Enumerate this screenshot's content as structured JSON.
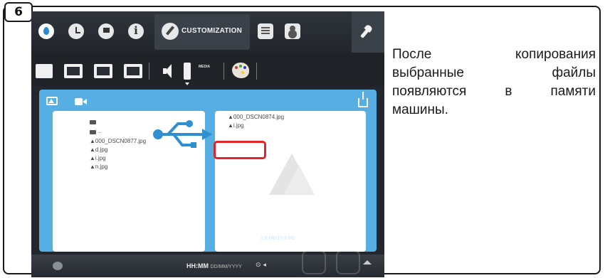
{
  "step_number": "6",
  "tabs": {
    "active_label": "CUSTOMIZATION"
  },
  "subbar": {
    "media_label": "MEDIA"
  },
  "usb_list": {
    "items": [
      {
        "type": "folder",
        "name": ""
      },
      {
        "type": "folder",
        "name": ".."
      },
      {
        "type": "image",
        "name": "000_DSCN0877.jpg"
      },
      {
        "type": "image",
        "name": "d.jpg"
      },
      {
        "type": "image",
        "name": "i.jpg"
      },
      {
        "type": "image",
        "name": "n.jpg"
      }
    ]
  },
  "machine_list": {
    "items": [
      {
        "type": "image",
        "name": "000_DSCN0874.jpg"
      },
      {
        "type": "image",
        "name": "i.jpg"
      }
    ]
  },
  "memory_capacity": "1.6 Mb/15.6 Mb",
  "status": {
    "time_format": "HH:MM",
    "date_format": "DD/MM/YYYY",
    "icons": "⊙ ◂"
  },
  "caption": {
    "line1": "После копирования",
    "line2": "выбранные файлы",
    "line3": "появляются в памяти",
    "line4": "машины."
  },
  "colors": {
    "panel_blue": "#57aee2",
    "usb_blue": "#2f8fd0",
    "highlight_red": "#e0242b"
  }
}
